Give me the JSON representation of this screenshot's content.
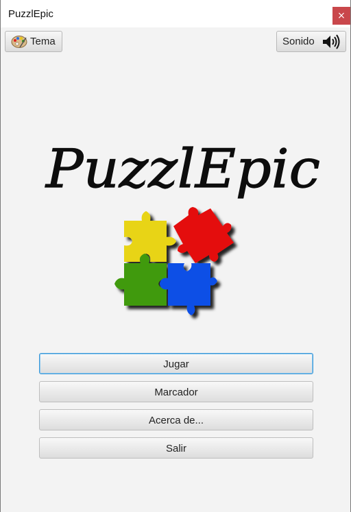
{
  "window": {
    "title": "PuzzlEpic",
    "close_glyph": "×"
  },
  "toolbar": {
    "theme_label": "Tema",
    "theme_icon": "palette-icon",
    "sound_label": "Sonido",
    "sound_icon": "speaker-icon"
  },
  "logo": {
    "text": "PuzzlEpic",
    "image": "puzzle-pieces-logo"
  },
  "menu": {
    "play_label": "Jugar",
    "scores_label": "Marcador",
    "about_label": "Acerca de...",
    "exit_label": "Salir"
  },
  "colors": {
    "close_red": "#c9474b",
    "focus_blue": "#3a97d7",
    "piece_yellow": "#e8d414",
    "piece_red": "#e41010",
    "piece_green": "#3f9a10",
    "piece_blue": "#1050e6"
  }
}
